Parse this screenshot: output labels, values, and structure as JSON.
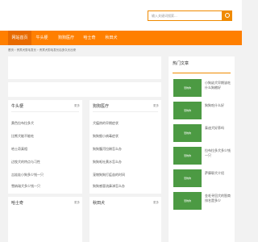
{
  "search": {
    "placeholder": "输入关键词搜索..."
  },
  "nav": {
    "items": [
      {
        "label": "网站首页",
        "active": true
      },
      {
        "label": "牛头梗",
        "active": false
      },
      {
        "label": "狗狗医疗",
        "active": false
      },
      {
        "label": "哈士奇",
        "active": false
      },
      {
        "label": "秋田犬",
        "active": false
      }
    ]
  },
  "breadcrumb": "首页 › 贵宾犬剪毛发长 › 贵宾犬剪毛发长后多久长出来",
  "columns": [
    {
      "title": "牛头梗",
      "more": "更多",
      "items": [
        "黄色拉布拉多犬",
        "比熊犬能不能吃",
        "哈士奇真相",
        "边牧犬的特点与习性",
        "吉娃娃小狗多少钱一只",
        "雪纳瑞犬多少钱一只"
      ]
    },
    {
      "title": "狗狗医疗",
      "more": "更多",
      "items": [
        "犬瘟热的早期症状",
        "狗狗细小病毒症状",
        "狗狗腹泻拉稀怎么办",
        "狗狗呕吐黄水怎么办",
        "宠物狗狗打疫苗的时间",
        "狗狗感冒流鼻涕怎么办"
      ]
    },
    {
      "title": "哈士奇",
      "more": "更多",
      "items": []
    },
    {
      "title": "秋田犬",
      "more": "更多",
      "items": []
    }
  ],
  "sidebar": {
    "title": "热门文章",
    "items": [
      {
        "thumb": "宠物狗",
        "title": "小狗幼犬早期该吃什么狗粮好"
      },
      {
        "thumb": "宠物狗",
        "title": "狗狗吃什么好"
      },
      {
        "thumb": "宠物狗",
        "title": "泰迪犬好养吗"
      },
      {
        "thumb": "宠物狗",
        "title": "拉布拉多犬多少钱一只"
      },
      {
        "thumb": "宠物狗",
        "title": "萨摩耶犬介绍"
      },
      {
        "thumb": "宠物狗",
        "title": "金毛寻回犬的智商排名是多少"
      }
    ]
  },
  "colors": {
    "accent": "#ff7f00",
    "thumb": "#4c9a43"
  }
}
